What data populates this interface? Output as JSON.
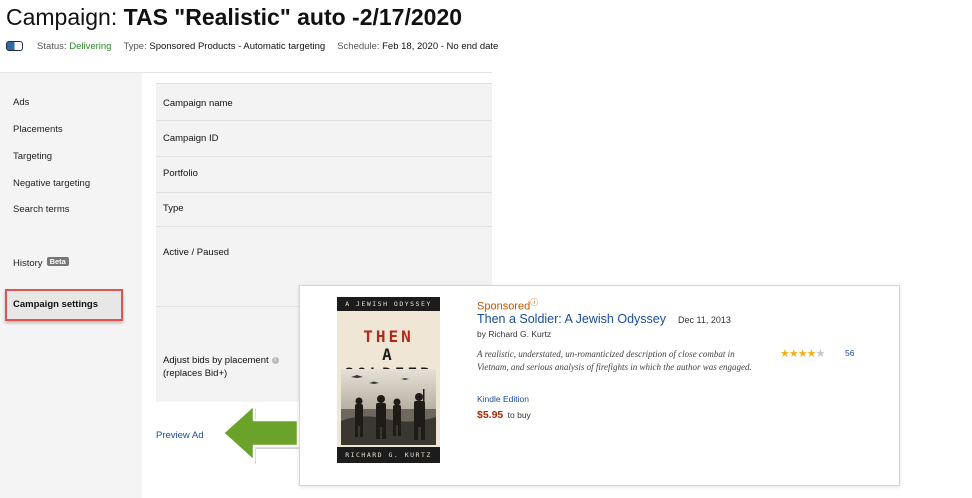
{
  "header": {
    "title_prefix": "Campaign:",
    "title_name": "TAS \"Realistic\" auto -2/17/2020",
    "status_label": "Status:",
    "status_value": "Delivering",
    "type_label": "Type:",
    "type_value": "Sponsored Products - Automatic targeting",
    "schedule_label": "Schedule:",
    "schedule_value": "Feb 18, 2020 - No end date",
    "toggle_state": "on"
  },
  "sidebar": {
    "items": [
      {
        "label": "Ads"
      },
      {
        "label": "Placements"
      },
      {
        "label": "Targeting"
      },
      {
        "label": "Negative targeting"
      },
      {
        "label": "Search terms"
      },
      {
        "label": "Campaign settings"
      },
      {
        "label": "History",
        "badge": "Beta"
      }
    ],
    "active_index": 5
  },
  "settings": {
    "rows": [
      {
        "label": "Campaign name"
      },
      {
        "label": "Campaign ID"
      },
      {
        "label": "Portfolio"
      },
      {
        "label": "Type"
      },
      {
        "label": "Active / Paused"
      },
      {
        "label": "Adjust bids by placement",
        "label2": "(replaces Bid+)"
      }
    ]
  },
  "preview_link": "Preview Ad",
  "ad": {
    "sponsored": "Sponsored",
    "title": "Then a Soldier: A Jewish Odyssey",
    "date": "Dec 11, 2013",
    "author": "by Richard G. Kurtz",
    "description": "A realistic, understated, un-romanticized description of close combat in Vietnam, and serious analysis of firefights in which the author was engaged.",
    "edition": "Kindle Edition",
    "price": "$5.95",
    "price_suffix": "to buy",
    "rating_stars": 4,
    "rating_max": 5,
    "review_count": "56",
    "cover": {
      "series": "A JEWISH ODYSSEY",
      "title_line1": "THEN",
      "title_line2": "A SOLDIER",
      "author": "RICHARD G. KURTZ"
    }
  },
  "colors": {
    "sidebar_bg": "#f4f4f4",
    "highlight_border": "#e0544f",
    "arrow_green": "#6aa22a",
    "link_blue": "#1a4d9c",
    "sponsored_orange": "#c45500",
    "price_red": "#b12704"
  }
}
